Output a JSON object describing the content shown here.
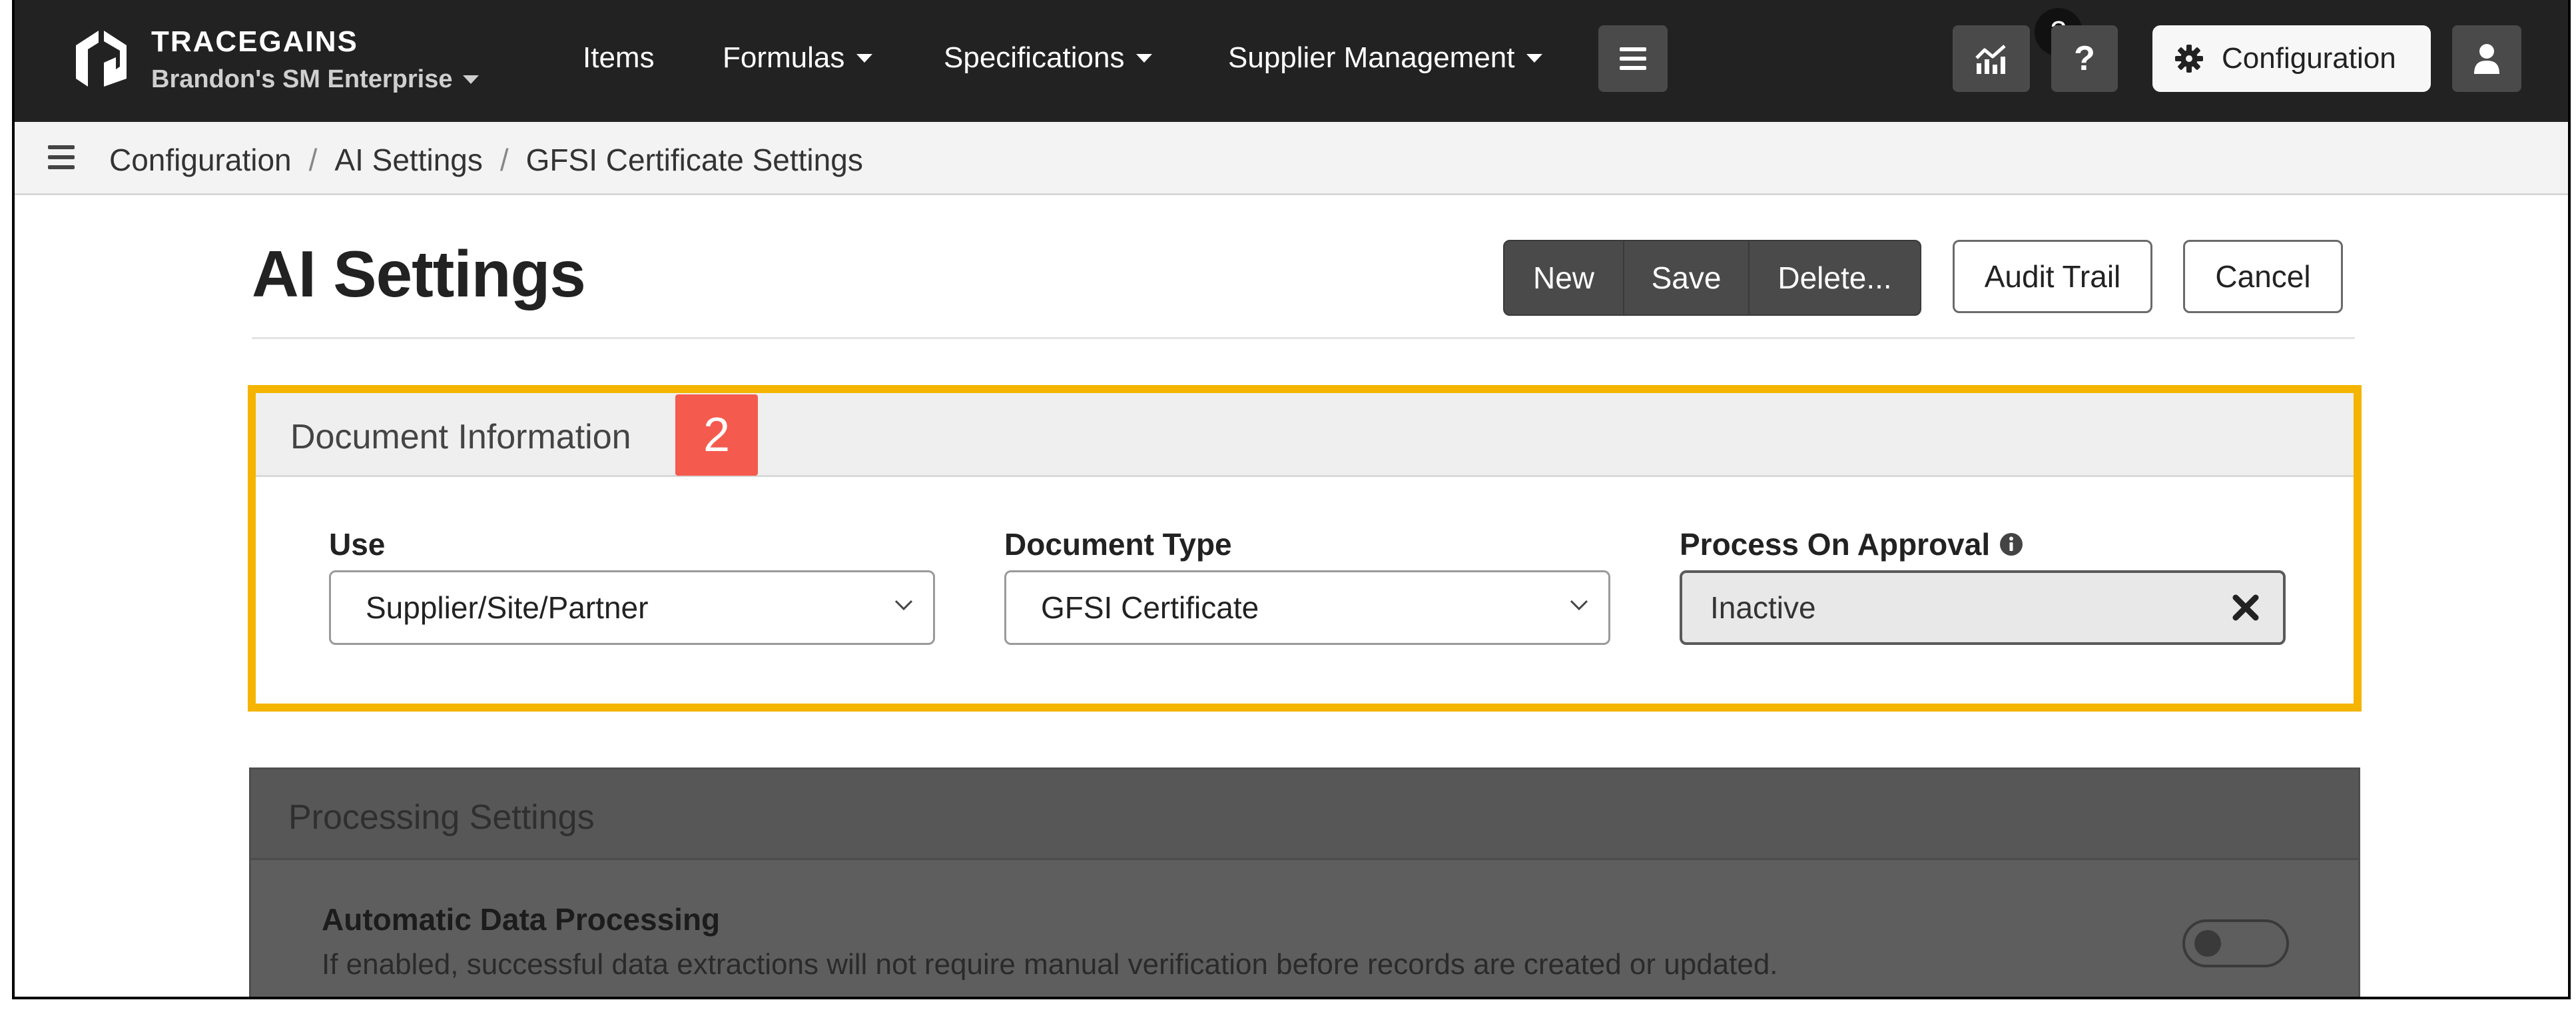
{
  "navbar": {
    "brand_name": "TRACEGAINS",
    "tenant": "Brandon's SM Enterprise",
    "links": [
      {
        "label": "Items"
      },
      {
        "label": "Formulas"
      },
      {
        "label": "Specifications"
      },
      {
        "label": "Supplier Management"
      }
    ],
    "notification_count": "2",
    "help_label": "?",
    "config_label": "Configuration"
  },
  "breadcrumb": [
    "Configuration",
    "AI Settings",
    "GFSI Certificate Settings"
  ],
  "page": {
    "title": "AI Settings",
    "actions": {
      "new": "New",
      "save": "Save",
      "delete": "Delete...",
      "audit_trail": "Audit Trail",
      "cancel": "Cancel"
    }
  },
  "document_info": {
    "title": "Document Information",
    "step_badge": "2",
    "use": {
      "label": "Use",
      "value": "Supplier/Site/Partner"
    },
    "document_type": {
      "label": "Document Type",
      "value": "GFSI Certificate"
    },
    "process_on_approval": {
      "label": "Process On Approval",
      "value": "Inactive"
    }
  },
  "processing_settings": {
    "title": "Processing Settings",
    "auto_processing": {
      "label": "Automatic Data Processing",
      "description": "If enabled, successful data extractions will not require manual verification before records are created or updated.",
      "enabled": false
    }
  },
  "colors": {
    "navbar": "#222222",
    "highlight_border": "#f4b400",
    "step_badge": "#f55a4e",
    "action_group": "#4a4a4a"
  }
}
